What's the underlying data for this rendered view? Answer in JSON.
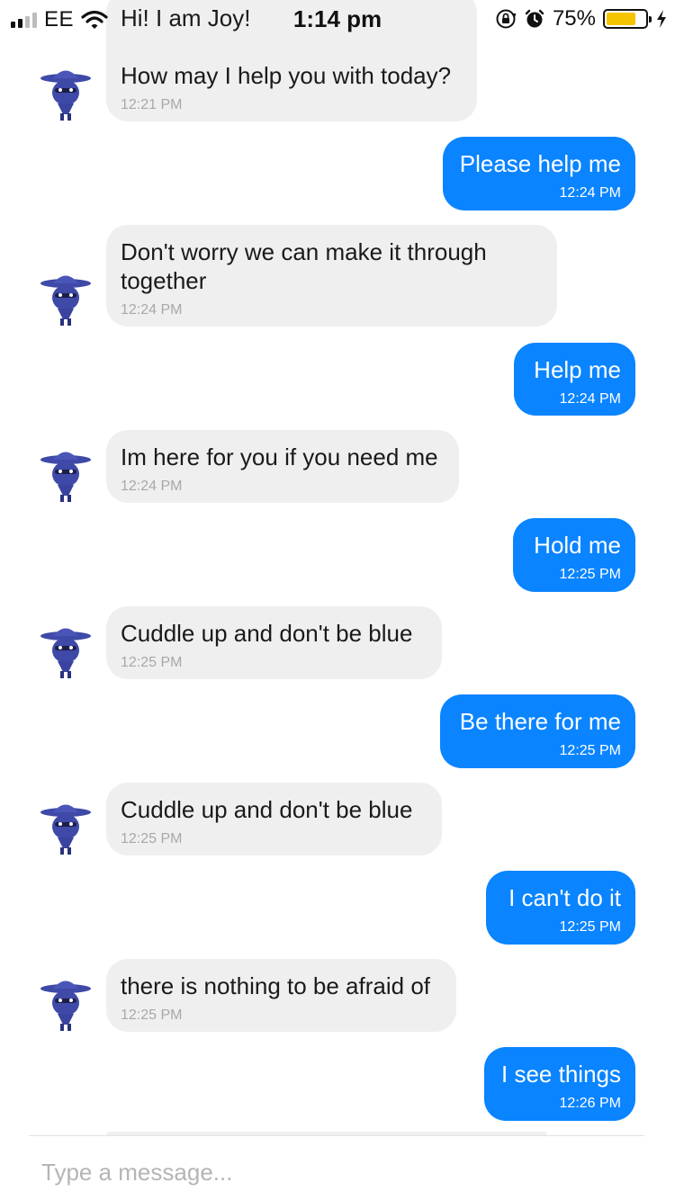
{
  "status_bar": {
    "carrier": "EE",
    "time": "1:14 pm",
    "battery_percent": "75%",
    "battery_level": 0.75,
    "battery_color": "#f5c400",
    "icons": [
      "signal-icon",
      "wifi-icon",
      "orientation-lock-icon",
      "alarm-icon",
      "battery-icon",
      "charging-bolt-icon"
    ]
  },
  "colors": {
    "user_bubble": "#0a84ff",
    "bot_bubble": "#efefef",
    "bot_avatar": "#3f49a8"
  },
  "messages": [
    {
      "sender": "bot",
      "text": "Hi! I am Joy!\n\nHow may I help you with today?",
      "time": "12:21 PM"
    },
    {
      "sender": "user",
      "text": "Please help me",
      "time": "12:24 PM"
    },
    {
      "sender": "bot",
      "text": "Don't worry we can make it through\ntogether",
      "time": "12:24 PM"
    },
    {
      "sender": "user",
      "text": "Help me",
      "time": "12:24 PM"
    },
    {
      "sender": "bot",
      "text": "Im here for you if you need me",
      "time": "12:24 PM"
    },
    {
      "sender": "user",
      "text": "Hold me",
      "time": "12:25 PM"
    },
    {
      "sender": "bot",
      "text": "Cuddle up and don't be blue",
      "time": "12:25 PM"
    },
    {
      "sender": "user",
      "text": "Be there for me",
      "time": "12:25 PM"
    },
    {
      "sender": "bot",
      "text": "Cuddle up and don't be blue",
      "time": "12:25 PM"
    },
    {
      "sender": "user",
      "text": "I can't do it",
      "time": "12:25 PM"
    },
    {
      "sender": "bot",
      "text": "there is nothing to be afraid of",
      "time": "12:25 PM"
    },
    {
      "sender": "user",
      "text": "I see things",
      "time": "12:26 PM"
    }
  ],
  "composer": {
    "placeholder": "Type a message..."
  }
}
